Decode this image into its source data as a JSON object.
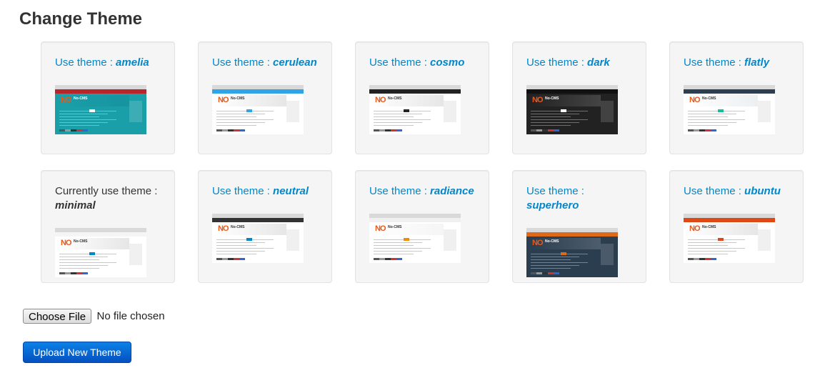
{
  "page": {
    "title": "Change Theme"
  },
  "prefix": {
    "use": "Use theme :",
    "current": "Currently use theme :"
  },
  "themes": [
    {
      "name": "amelia",
      "current": false,
      "nav": "#b8262c",
      "bg": "#1a9fa8",
      "hero": "#1694a0",
      "text": "#ffffff"
    },
    {
      "name": "cerulean",
      "current": false,
      "nav": "#2fa4e7",
      "bg": "#ffffff",
      "hero": "#e6e6e6",
      "text": "#2fa4e7"
    },
    {
      "name": "cosmo",
      "current": false,
      "nav": "#222222",
      "bg": "#ffffff",
      "hero": "#e6e6e6",
      "text": "#222222"
    },
    {
      "name": "dark",
      "current": false,
      "nav": "#111111",
      "bg": "#222222",
      "hero": "#444444",
      "text": "#ffffff"
    },
    {
      "name": "flatly",
      "current": false,
      "nav": "#2c3e50",
      "bg": "#ffffff",
      "hero": "#ecf0f1",
      "text": "#18bc9c"
    },
    {
      "name": "minimal",
      "current": true,
      "nav": "#f5f5f5",
      "bg": "#ffffff",
      "hero": "#e6e6e6",
      "text": "#0088cc"
    },
    {
      "name": "neutral",
      "current": false,
      "nav": "#333333",
      "bg": "#ffffff",
      "hero": "#e6e6e6",
      "text": "#0088cc"
    },
    {
      "name": "radiance",
      "current": false,
      "nav": "#f0f0f0",
      "bg": "#ffffff",
      "hero": "#f5f5f5",
      "text": "#f08c00"
    },
    {
      "name": "superhero",
      "current": false,
      "nav": "#df691a",
      "bg": "#2b3e50",
      "hero": "#4e5d6c",
      "text": "#df691a"
    },
    {
      "name": "ubuntu",
      "current": false,
      "nav": "#dd4814",
      "bg": "#ffffff",
      "hero": "#e6e6e6",
      "text": "#dd4814"
    }
  ],
  "thumb": {
    "logo": "NO",
    "brand": "No-CMS"
  },
  "file": {
    "choose_label": "Choose File",
    "status": "No file chosen"
  },
  "upload": {
    "label": "Upload New Theme"
  }
}
